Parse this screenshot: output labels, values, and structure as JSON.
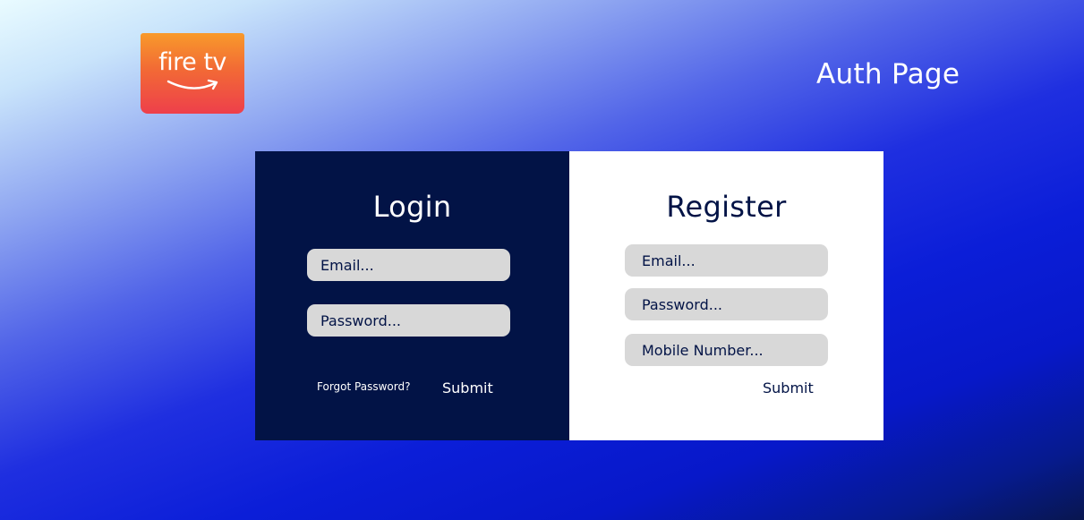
{
  "logo": {
    "text": "fire tv",
    "icon": "amazon-smile-icon"
  },
  "page": {
    "title": "Auth Page"
  },
  "login": {
    "title": "Login",
    "email_placeholder": "Email...",
    "password_placeholder": "Password...",
    "forgot_label": "Forgot Password?",
    "submit_label": "Submit"
  },
  "register": {
    "title": "Register",
    "email_placeholder": "Email...",
    "password_placeholder": "Password...",
    "mobile_placeholder": "Mobile Number...",
    "submit_label": "Submit"
  },
  "colors": {
    "navy": "#021346",
    "field_bg": "#d8d8d8",
    "logo_top": "#f89a2b",
    "logo_bottom": "#ee3f4b",
    "background_blue": "#0b1ed8"
  }
}
